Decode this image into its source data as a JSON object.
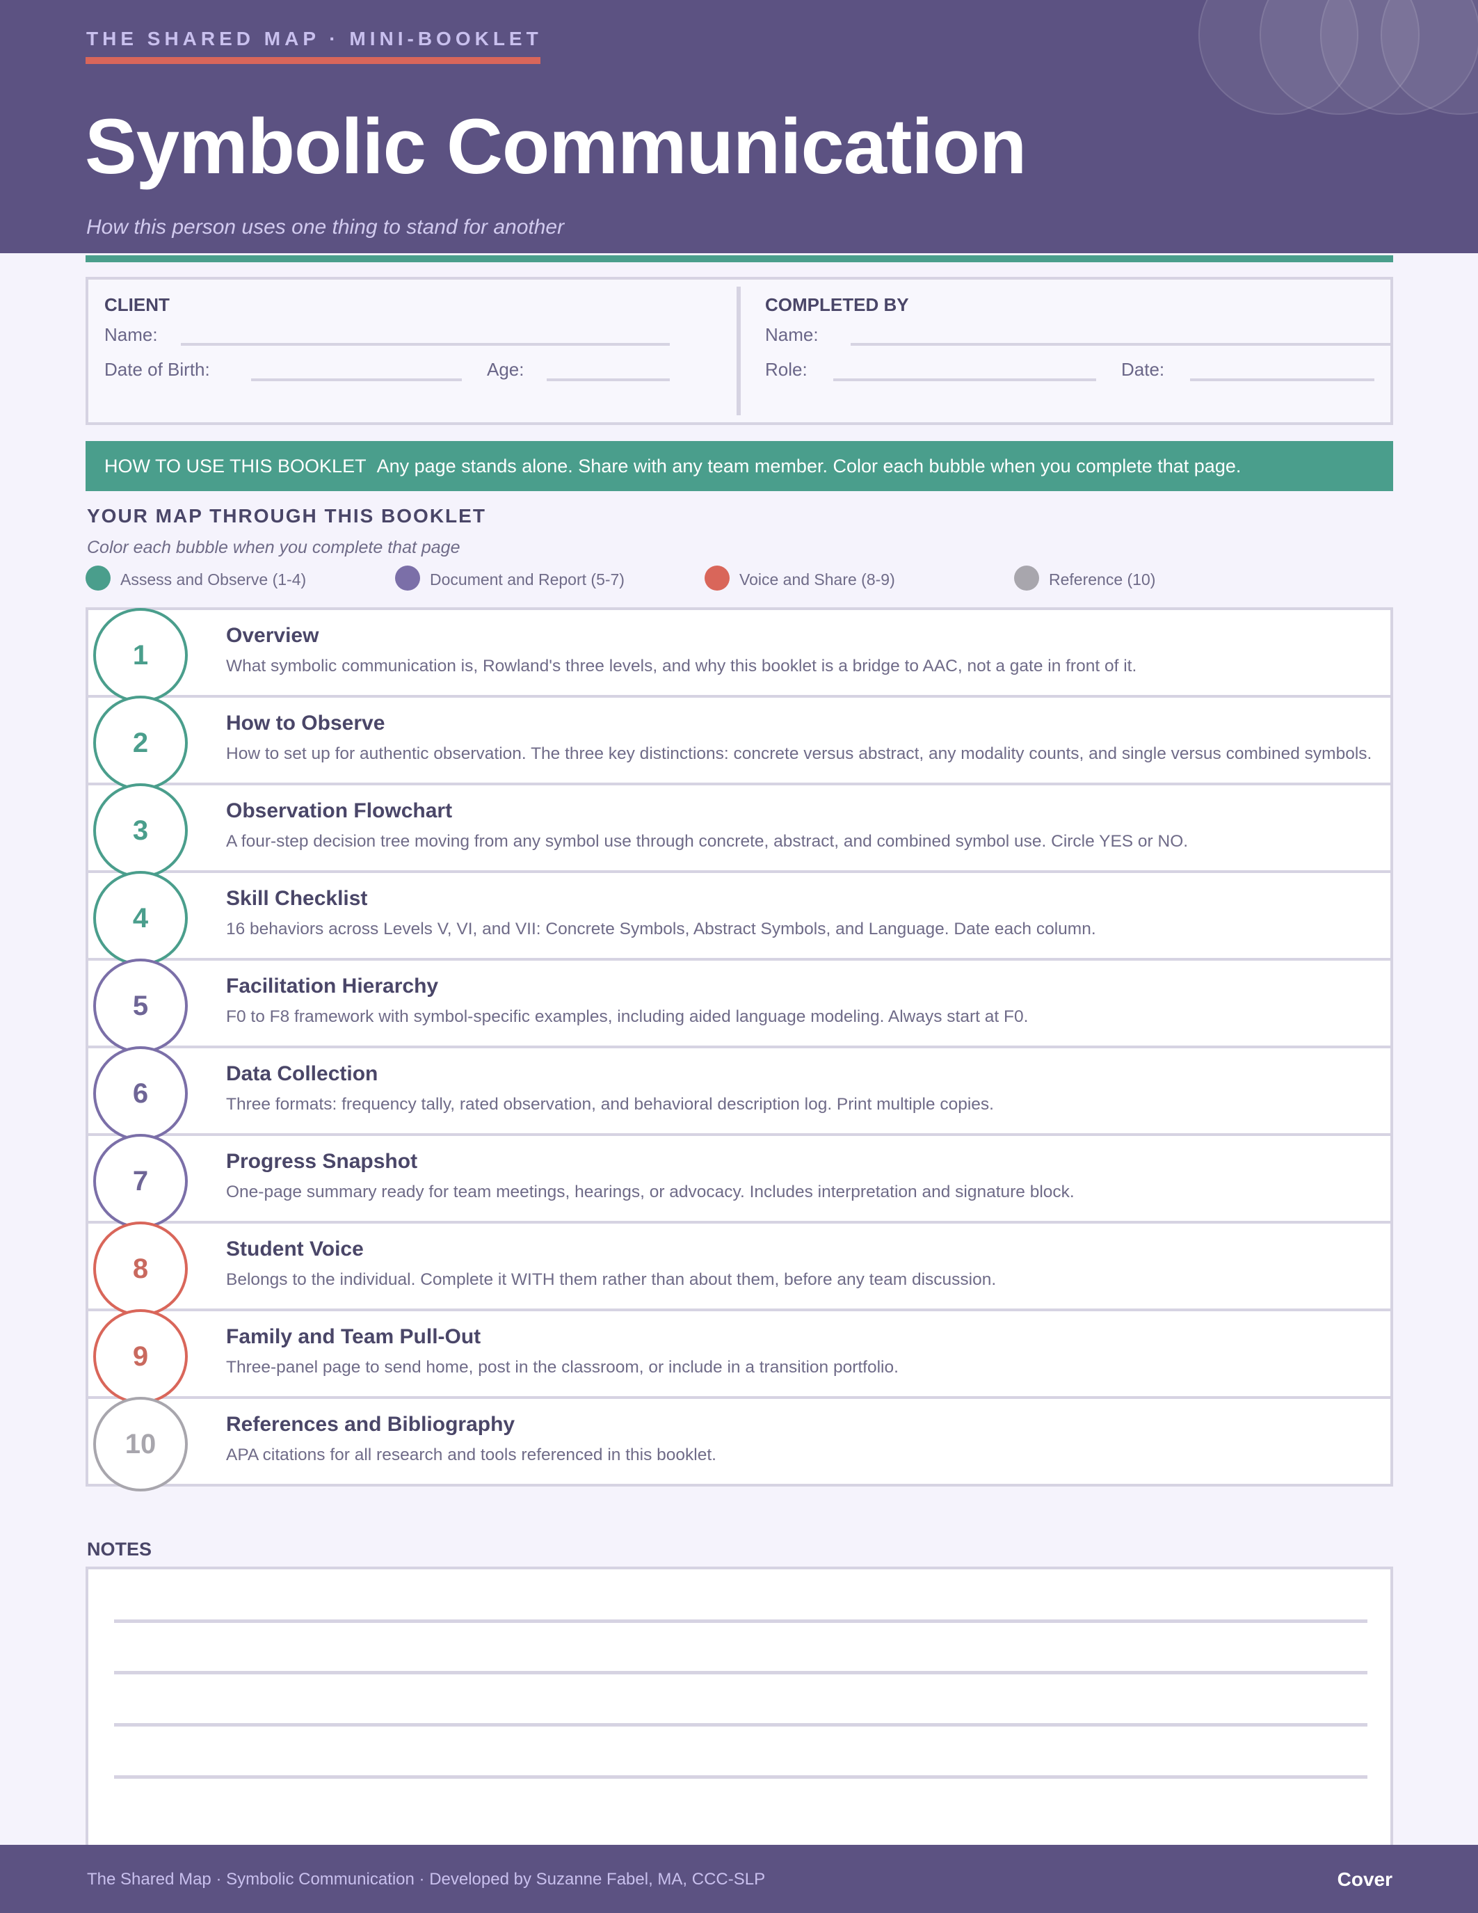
{
  "header": {
    "eyebrow": "THE SHARED MAP  ·  MINI-BOOKLET",
    "title": "Symbolic Communication",
    "subtitle": "How this person uses one thing to stand for another"
  },
  "client": {
    "heading": "CLIENT",
    "name_label": "Name:",
    "dob_label": "Date of Birth:",
    "age_label": "Age:"
  },
  "completed_by": {
    "heading": "COMPLETED BY",
    "name_label": "Name:",
    "role_label": "Role:",
    "date_label": "Date:"
  },
  "howto": {
    "label": "HOW TO USE THIS BOOKLET",
    "text": "Any page stands alone.  Share with any team member.  Color each bubble when you complete that page."
  },
  "map": {
    "title": "YOUR MAP THROUGH THIS BOOKLET",
    "subtitle": "Color each bubble when you complete that page",
    "legend": [
      {
        "label": "Assess and Observe  (1-4)",
        "color": "#4a9e8c"
      },
      {
        "label": "Document and Report  (5-7)",
        "color": "#7b6fa8"
      },
      {
        "label": "Voice and Share  (8-9)",
        "color": "#d9665a"
      },
      {
        "label": "Reference  (10)",
        "color": "#a8a6ad"
      }
    ]
  },
  "pages": [
    {
      "num": "1",
      "title": "Overview",
      "desc": "What symbolic communication is, Rowland's three levels, and why this booklet is a bridge to AAC, not a gate in front of it.",
      "color": "#4a9e8c"
    },
    {
      "num": "2",
      "title": "How to Observe",
      "desc": "How to set up for authentic observation.  The three key distinctions: concrete versus abstract, any modality counts, and single versus combined symbols.",
      "color": "#4a9e8c"
    },
    {
      "num": "3",
      "title": "Observation Flowchart",
      "desc": "A four-step decision tree moving from any symbol use through concrete, abstract, and combined symbol use.  Circle YES or NO.",
      "color": "#4a9e8c"
    },
    {
      "num": "4",
      "title": "Skill Checklist",
      "desc": "16 behaviors across Levels V, VI, and VII: Concrete Symbols, Abstract Symbols, and Language.  Date each column.",
      "color": "#4a9e8c"
    },
    {
      "num": "5",
      "title": "Facilitation Hierarchy",
      "desc": "F0 to F8 framework with symbol-specific examples, including aided language modeling.  Always start at F0.",
      "color": "#6e6596"
    },
    {
      "num": "6",
      "title": "Data Collection",
      "desc": "Three formats: frequency tally, rated observation, and behavioral description log.  Print multiple copies.",
      "color": "#6e6596"
    },
    {
      "num": "7",
      "title": "Progress Snapshot",
      "desc": "One-page summary ready for team meetings, hearings, or advocacy.  Includes interpretation and signature block.",
      "color": "#6e6596"
    },
    {
      "num": "8",
      "title": "Student Voice",
      "desc": "Belongs to the individual.  Complete it WITH them rather than about them, before any team discussion.",
      "color": "#c9695e"
    },
    {
      "num": "9",
      "title": "Family and Team Pull-Out",
      "desc": "Three-panel page to send home, post in the classroom, or include in a transition portfolio.",
      "color": "#c9695e"
    },
    {
      "num": "10",
      "title": "References and Bibliography",
      "desc": "APA citations for all research and tools referenced in this booklet.",
      "color": "#a8a6ad"
    }
  ],
  "notes": {
    "title": "NOTES"
  },
  "footer": {
    "left": "The Shared Map  ·  Symbolic Communication  ·  Developed by Suzanne Fabel, MA, CCC-SLP",
    "right": "Cover"
  }
}
